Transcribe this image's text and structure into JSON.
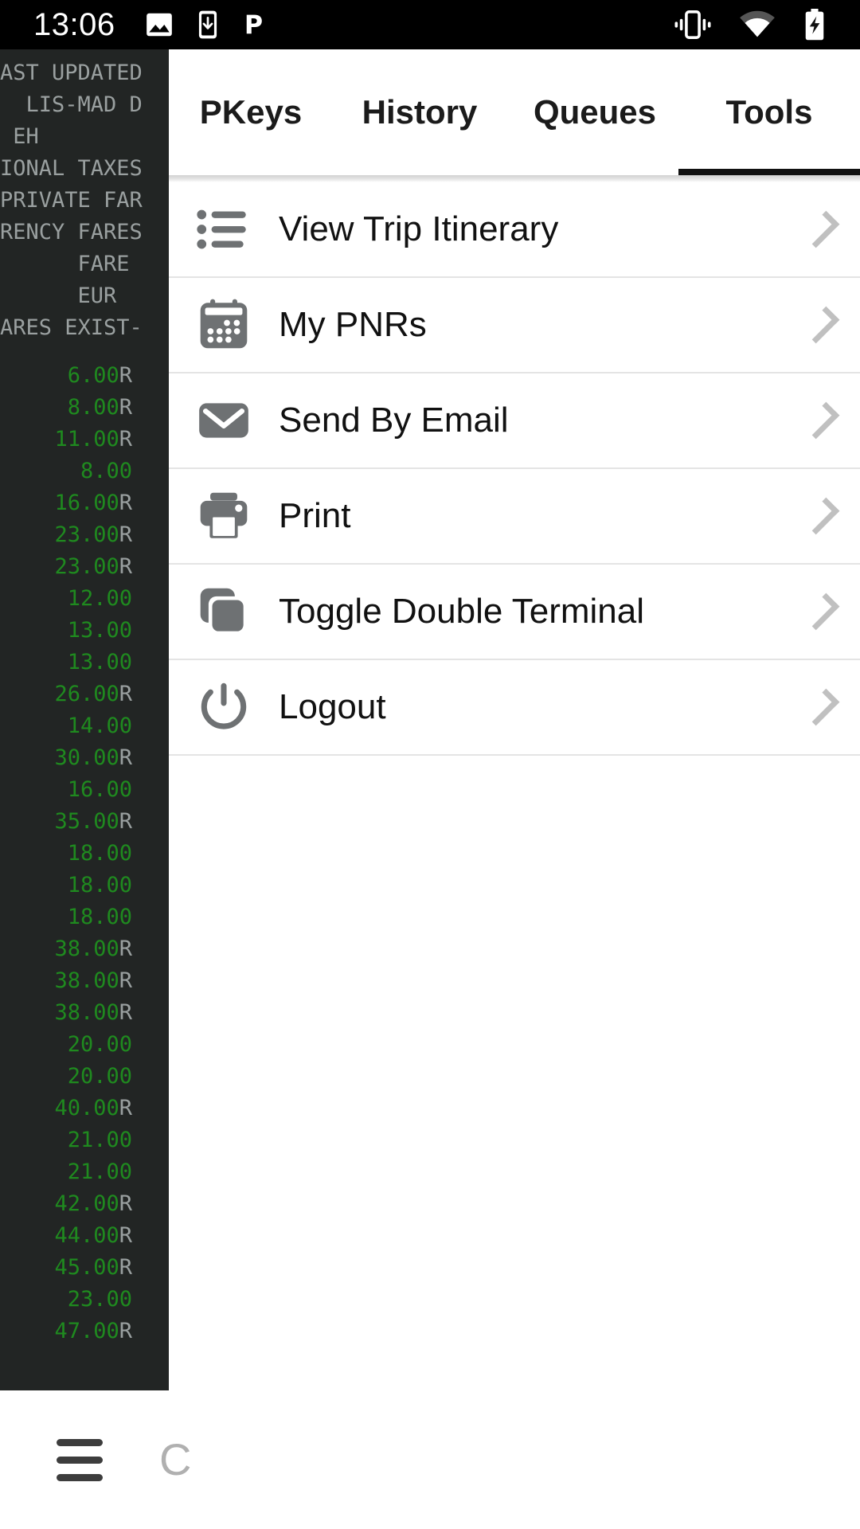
{
  "statusbar": {
    "time": "13:06",
    "left_icons": [
      "image-icon",
      "download-to-device-icon",
      "p-app-icon"
    ],
    "right_icons": [
      "vibrate-icon",
      "wifi-icon",
      "battery-charging-icon"
    ],
    "background_color": "#000000",
    "foreground_color": "#ffffff"
  },
  "terminal": {
    "background_color": "#222524",
    "text_color": "#9aa0a0",
    "value_color": "#1f8a1f",
    "lines": [
      "AST UPDATED",
      "  LIS-MAD D",
      " EH",
      "IONAL TAXES",
      "PRIVATE FAR",
      "RENCY FARES",
      "      FARE",
      "      EUR",
      "ARES EXIST-"
    ],
    "values": [
      {
        "amount": "6.00",
        "suffix": "R"
      },
      {
        "amount": "8.00",
        "suffix": "R"
      },
      {
        "amount": "11.00",
        "suffix": "R"
      },
      {
        "amount": "8.00",
        "suffix": ""
      },
      {
        "amount": "16.00",
        "suffix": "R"
      },
      {
        "amount": "23.00",
        "suffix": "R"
      },
      {
        "amount": "23.00",
        "suffix": "R"
      },
      {
        "amount": "12.00",
        "suffix": ""
      },
      {
        "amount": "13.00",
        "suffix": ""
      },
      {
        "amount": "13.00",
        "suffix": ""
      },
      {
        "amount": "26.00",
        "suffix": "R"
      },
      {
        "amount": "14.00",
        "suffix": ""
      },
      {
        "amount": "30.00",
        "suffix": "R"
      },
      {
        "amount": "16.00",
        "suffix": ""
      },
      {
        "amount": "35.00",
        "suffix": "R"
      },
      {
        "amount": "18.00",
        "suffix": ""
      },
      {
        "amount": "18.00",
        "suffix": ""
      },
      {
        "amount": "18.00",
        "suffix": ""
      },
      {
        "amount": "38.00",
        "suffix": "R"
      },
      {
        "amount": "38.00",
        "suffix": "R"
      },
      {
        "amount": "38.00",
        "suffix": "R"
      },
      {
        "amount": "20.00",
        "suffix": ""
      },
      {
        "amount": "20.00",
        "suffix": ""
      },
      {
        "amount": "40.00",
        "suffix": "R"
      },
      {
        "amount": "21.00",
        "suffix": ""
      },
      {
        "amount": "21.00",
        "suffix": ""
      },
      {
        "amount": "42.00",
        "suffix": "R"
      },
      {
        "amount": "44.00",
        "suffix": "R"
      },
      {
        "amount": "45.00",
        "suffix": "R"
      },
      {
        "amount": "23.00",
        "suffix": ""
      },
      {
        "amount": "47.00",
        "suffix": "R"
      }
    ]
  },
  "panel": {
    "tabs": [
      {
        "label": "PKeys",
        "active": false
      },
      {
        "label": "History",
        "active": false
      },
      {
        "label": "Queues",
        "active": false
      },
      {
        "label": "Tools",
        "active": true
      }
    ],
    "active_tab_indicator_color": "#111111",
    "menu_items": [
      {
        "label": "View Trip Itinerary",
        "icon": "list-icon",
        "chevron": "chevron-right-icon"
      },
      {
        "label": "My PNRs",
        "icon": "calendar-icon",
        "chevron": "chevron-right-icon"
      },
      {
        "label": "Send By Email",
        "icon": "envelope-icon",
        "chevron": "chevron-right-icon"
      },
      {
        "label": "Print",
        "icon": "printer-icon",
        "chevron": "chevron-right-icon"
      },
      {
        "label": "Toggle Double Terminal",
        "icon": "layers-icon",
        "chevron": "chevron-right-icon"
      },
      {
        "label": "Logout",
        "icon": "power-icon",
        "chevron": "chevron-right-icon"
      }
    ]
  },
  "bottombar": {
    "menu_icon": "hamburger-menu-icon",
    "letter": "C"
  }
}
